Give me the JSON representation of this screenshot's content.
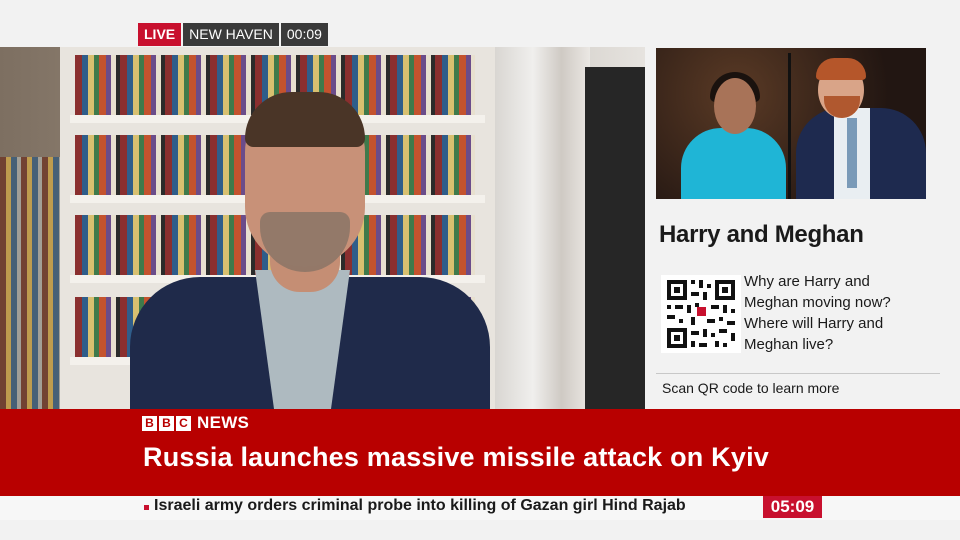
{
  "live_bug": {
    "live": "LIVE",
    "location": "NEW HAVEN",
    "elapsed": "00:09"
  },
  "side_panel": {
    "title": "Harry and Meghan",
    "questions": [
      "Why are Harry and",
      "Meghan moving now?",
      "Where will Harry and",
      "Meghan live?"
    ],
    "cta": "Scan QR code to learn more"
  },
  "lower_third": {
    "brand_letters": [
      "B",
      "B",
      "C"
    ],
    "brand_word": "NEWS",
    "headline": "Russia launches massive missile attack on Kyiv"
  },
  "ticker": {
    "text": "Israeli army orders criminal probe into killing of Gazan girl Hind Rajab",
    "clock": "05:09"
  },
  "colors": {
    "bbc_red": "#b80000",
    "live_red": "#c8102e",
    "tag_grey": "#3a3a3a"
  }
}
